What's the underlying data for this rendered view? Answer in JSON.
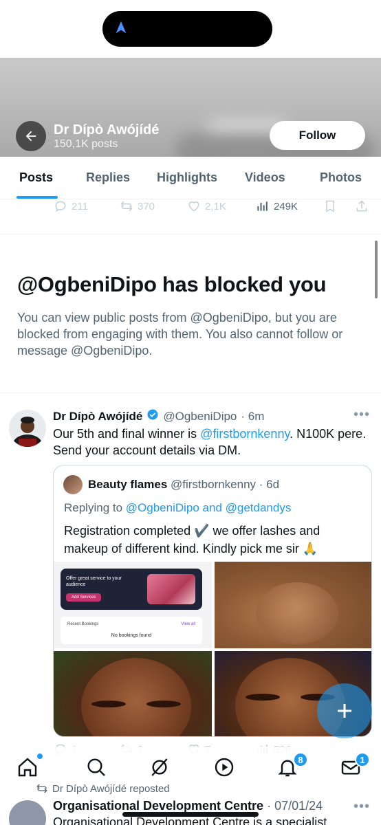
{
  "header": {
    "name": "Dr Dípò Awójídé",
    "posts_count": "150,1K posts",
    "follow_label": "Follow"
  },
  "tabs": [
    {
      "label": "Posts",
      "active": true
    },
    {
      "label": "Replies",
      "active": false
    },
    {
      "label": "Highlights",
      "active": false
    },
    {
      "label": "Videos",
      "active": false
    },
    {
      "label": "Photos",
      "active": false
    }
  ],
  "prev_post_actions": {
    "replies": "211",
    "reposts": "370",
    "likes": "2,1K",
    "views": "249K"
  },
  "blocked": {
    "title": "@OgbeniDipo has blocked you",
    "message": "You can view public posts from @OgbeniDipo, but you are blocked from engaging with them. You also cannot follow or message @OgbeniDipo."
  },
  "tweet": {
    "name": "Dr Dípò Awójídé",
    "handle": "@OgbeniDipo",
    "time": "· 6m",
    "text_before": "Our 5th and final winner is ",
    "mention": "@firstbornkenny",
    "text_after": ". N100K pere. Send your account details via DM.",
    "actions": {
      "replies": "1",
      "reposts": "2",
      "likes": "7",
      "views": "526"
    }
  },
  "quote": {
    "name": "Beauty flames",
    "handle": "@firstbornkenny",
    "time": "· 6d",
    "replying_prefix": "Replying to ",
    "replying_to": "@OgbeniDipo and @getdandys",
    "text": "Registration completed ✔️ we offer lashes and makeup of different kind. Kindly pick me sir 🙏",
    "app_card": {
      "headline": "Offer great service to your audience",
      "button": "Add Services",
      "recent": "Recent Bookings",
      "view_all": "View all",
      "empty": "No bookings found"
    }
  },
  "nav": {
    "notifications_badge": "8",
    "messages_badge": "1"
  },
  "next_post": {
    "repost_label": "Dr Dípò Awójídé reposted",
    "name": "Organisational Development Centre",
    "time": "· 07/01/24",
    "text": "Organisational Development Centre is a specialist"
  },
  "colors": {
    "accent": "#1d9bf0",
    "text_primary": "#0f1419",
    "text_secondary": "#536471"
  }
}
